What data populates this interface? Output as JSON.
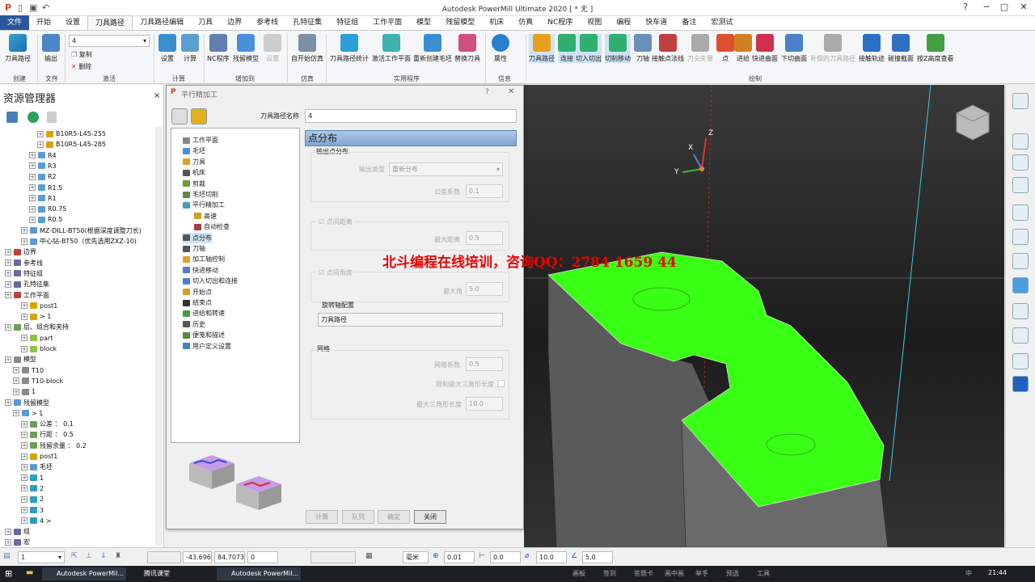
{
  "app": {
    "title": "Autodesk PowerMill Ultimate 2020   [ * 无 ]"
  },
  "ribbon_tabs": [
    "文件",
    "开始",
    "设置",
    "刀具路径",
    "刀具路径编辑",
    "刀具",
    "边界",
    "参考线",
    "孔特征集",
    "特征组",
    "工作平面",
    "模型",
    "残留模型",
    "机床",
    "仿真",
    "NC程序",
    "视图",
    "编程",
    "快车道",
    "备注",
    "宏测试"
  ],
  "ribbon": {
    "create": {
      "label": "创建",
      "btn": "刀具路径"
    },
    "file": {
      "label": "文件",
      "btn": "输出"
    },
    "activate": {
      "label": "激活",
      "value": "4",
      "copy": "复制",
      "delete": "删除"
    },
    "calc": {
      "label": "计算",
      "settings": "设置",
      "calculate": "计算"
    },
    "addto": {
      "label": "增加到",
      "nc": "NC程序",
      "stock": "残留模型",
      "settings": "设置"
    },
    "sim": {
      "label": "仿真",
      "start": "自开始仿真"
    },
    "util": {
      "label": "实用程序",
      "stats": "刀具路径统计",
      "workplane": "激活工作平面",
      "regen": "重新创建毛坯",
      "swap": "替换刀具"
    },
    "info": {
      "label": "信息",
      "props": "属性"
    },
    "draw": {
      "label": "绘制",
      "items": [
        "刀具路径",
        "连接",
        "切入切出",
        "切削移动",
        "刀轴",
        "接触点法线",
        "刀尖矢量",
        "点",
        "进给",
        "快进曲面",
        "下切曲面",
        "补偿的刀具路径",
        "接触轨迹",
        "碰撞截面",
        "按Z高度查看"
      ]
    }
  },
  "explorer": {
    "title": "资源管理器",
    "rows": [
      {
        "indent": 4,
        "text": "B10R5-L45-255",
        "color": "#d9a300"
      },
      {
        "indent": 4,
        "text": "B10R5-L45-285",
        "color": "#d9a300"
      },
      {
        "indent": 3,
        "text": "R4",
        "color": "#5b9bd5"
      },
      {
        "indent": 3,
        "text": "R3",
        "color": "#5b9bd5"
      },
      {
        "indent": 3,
        "text": "R2",
        "color": "#5b9bd5"
      },
      {
        "indent": 3,
        "text": "R1.5",
        "color": "#5b9bd5"
      },
      {
        "indent": 3,
        "text": "R1",
        "color": "#5b9bd5"
      },
      {
        "indent": 3,
        "text": "R0.75",
        "color": "#5b9bd5"
      },
      {
        "indent": 3,
        "text": "R0.5",
        "color": "#5b9bd5"
      },
      {
        "indent": 2,
        "text": "MZ-DILL-BT50(根据深度调整刀长)",
        "color": "#5b9bd5"
      },
      {
        "indent": 2,
        "text": "中心钻-BT50（优先选用ZXZ-10)",
        "color": "#5b9bd5"
      },
      {
        "indent": 0,
        "text": "边界",
        "color": "#c04040"
      },
      {
        "indent": 0,
        "text": "参考线",
        "color": "#6a6aa0"
      },
      {
        "indent": 0,
        "text": "特征组",
        "color": "#6a6aa0"
      },
      {
        "indent": 0,
        "text": "孔特征集",
        "color": "#6a6aa0"
      },
      {
        "indent": 0,
        "text": "工作平面",
        "color": "#c04040"
      },
      {
        "indent": 2,
        "text": "post1",
        "color": "#d9a300"
      },
      {
        "indent": 2,
        "text": "> 1",
        "color": "#d9a300"
      },
      {
        "indent": 0,
        "text": "层、组合和夹持",
        "color": "#6aa05a"
      },
      {
        "indent": 2,
        "text": "part",
        "color": "#8dc34a"
      },
      {
        "indent": 2,
        "text": "block",
        "color": "#8dc34a"
      },
      {
        "indent": 0,
        "text": "模型",
        "color": "#8a8a8a"
      },
      {
        "indent": 1,
        "text": "T10",
        "color": "#8a8a8a"
      },
      {
        "indent": 1,
        "text": "T10-block",
        "color": "#8a8a8a"
      },
      {
        "indent": 1,
        "text": "1",
        "color": "#8a8a8a"
      },
      {
        "indent": 0,
        "text": "残留模型",
        "color": "#5b9bd5"
      },
      {
        "indent": 1,
        "text": "> 1",
        "color": "#5b9bd5"
      },
      {
        "indent": 2,
        "text": "公差 ： 0.1",
        "color": "#6aa05a"
      },
      {
        "indent": 2,
        "text": "行距 ： 0.5",
        "color": "#6aa05a"
      },
      {
        "indent": 2,
        "text": "残留余量 ： 0.2",
        "color": "#6aa05a"
      },
      {
        "indent": 2,
        "text": "post1",
        "color": "#d9a300"
      },
      {
        "indent": 2,
        "text": "毛坯",
        "color": "#5b9bd5"
      },
      {
        "indent": 2,
        "text": "1",
        "color": "#2aa0c0"
      },
      {
        "indent": 2,
        "text": "2",
        "color": "#2aa0c0"
      },
      {
        "indent": 2,
        "text": "2",
        "color": "#2aa0c0"
      },
      {
        "indent": 2,
        "text": "3",
        "color": "#2aa0c0"
      },
      {
        "indent": 2,
        "text": "4 >",
        "color": "#2aa0c0"
      },
      {
        "indent": 0,
        "text": "组",
        "color": "#6a6aa0"
      },
      {
        "indent": 0,
        "text": "宏",
        "color": "#6a6aa0"
      }
    ]
  },
  "dialog": {
    "title": "平行精加工",
    "name_label": "刀具路径名称",
    "name_value": "4",
    "tree": [
      "工作平面",
      "毛坯",
      "刀具",
      "机床",
      "剪裁",
      "毛坯切削",
      "平行精加工",
      "高速",
      "自动检查",
      "点分布",
      "刀轴",
      "加工轴控制",
      "快进移动",
      "切入切出和连接",
      "开始点",
      "结束点",
      "进给和转速",
      "历史",
      "便笺和描述",
      "用户定义设置"
    ],
    "panel_title": "点分布",
    "output_group": "输出点分布",
    "output_type_label": "输出类型",
    "output_type_value": "重新分布",
    "tolerance_factor_label": "公差系数",
    "tolerance_factor_value": "0.1",
    "point_distance_label": "点间距离",
    "max_distance_label": "最大距离",
    "max_distance_value": "0.5",
    "point_angle_label": "点间角度",
    "max_angle_label": "最大角",
    "max_angle_value": "5.0",
    "rot_axis_label": "旋转轴配置",
    "rot_axis_value": "刀具路径",
    "mesh_group": "网格",
    "mesh_factor_label": "网格系数",
    "mesh_factor_value": "0.5",
    "limit_tri_label": "限制最大三角形长度",
    "max_tri_label": "最大三角形长度",
    "max_tri_value": "10.0",
    "buttons": {
      "calc": "计算",
      "queue": "队列",
      "ok": "确定",
      "close": "关闭"
    }
  },
  "watermark": "北斗编程在线培训，咨询QQ：2784 1659 44",
  "statusbar": {
    "layer": "1",
    "x": "-43.696",
    "y": "84.7073",
    "z": "0",
    "units": "毫米",
    "tol": "0.01",
    "thick": "0.0",
    "diam": "10.0",
    "angle": "5.0"
  },
  "taskbar": {
    "items": [
      "Autodesk PowerMil...",
      "腾讯课堂",
      "Autodesk PowerMil..."
    ],
    "tray": [
      "画板",
      "签到",
      "答题卡",
      "画中画",
      "举手",
      "预选",
      "工具"
    ],
    "time": "21:44",
    "ime": "中"
  },
  "colors": {
    "accent": "#2b579a",
    "finish": "#39ff14"
  }
}
